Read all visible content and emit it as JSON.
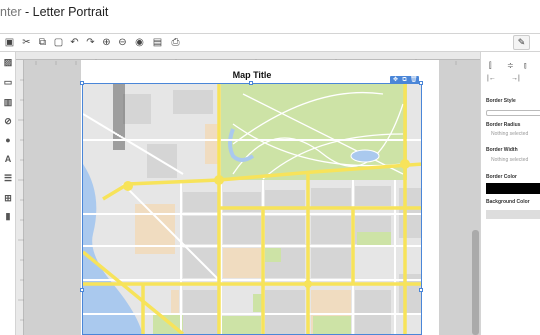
{
  "window": {
    "app_name": "nter",
    "separator": " - ",
    "document_name": "Letter Portrait"
  },
  "toolbar": {
    "tools": [
      "layout-icon",
      "cut-icon",
      "copy-icon",
      "paste-icon",
      "undo-icon",
      "redo-icon",
      "zoom-in-icon",
      "zoom-out-icon",
      "preview-icon",
      "image-icon",
      "print-icon"
    ],
    "glyphs": [
      "▣",
      "✂",
      "⧉",
      "▢",
      "↶",
      "↷",
      "⊕",
      "⊖",
      "◉",
      "▤",
      "⎙"
    ],
    "pen_glyph": "✎"
  },
  "leftbar": {
    "tools": [
      "image-tool-icon",
      "shape-tool-icon",
      "map-tool-icon",
      "location-tool-icon",
      "info-tool-icon",
      "text-tool-icon",
      "list-tool-icon",
      "table-tool-icon",
      "document-tool-icon"
    ],
    "glyphs": [
      "▨",
      "▭",
      "▥",
      "⊘",
      "●",
      "A",
      "☰",
      "⊞",
      "▮"
    ]
  },
  "map": {
    "title": "Map Title",
    "controls": [
      "✥",
      "⧉",
      "🗑"
    ],
    "colors": {
      "land": "#e6e6e6",
      "block": "#d5d5d5",
      "park": "#cde3a6",
      "river": "#aac9ee",
      "road": "#f7e35a",
      "sand": "#f0dcc0"
    }
  },
  "panel": {
    "align_glyphs": [
      "⫿",
      "≑",
      "⫾",
      "|←",
      "→|"
    ],
    "border_style_label": "Border Style",
    "border_radius_label": "Border Radius",
    "border_radius_value": "Nothing selected",
    "border_width_label": "Border Width",
    "border_width_value": "Nothing selected",
    "border_color_label": "Border Color",
    "border_color": "#000000",
    "background_color_label": "Background Color",
    "background_color": "#dddddd"
  }
}
